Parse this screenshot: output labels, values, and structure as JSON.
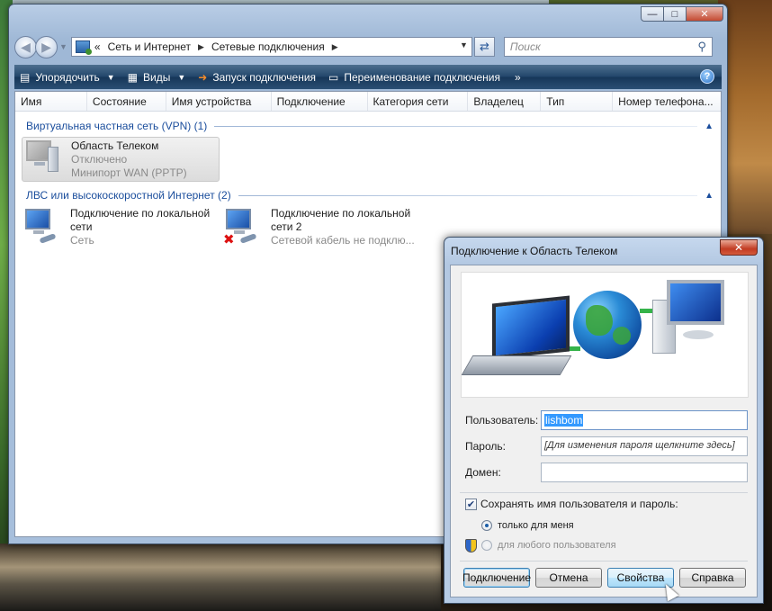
{
  "explorer": {
    "address": {
      "prefix": "«",
      "crumbs": [
        "Сеть и Интернет",
        "Сетевые подключения"
      ]
    },
    "search_placeholder": "Поиск",
    "toolbar": {
      "organize": "Упорядочить",
      "views": "Виды",
      "start_connection": "Запуск подключения",
      "rename_connection": "Переименование подключения",
      "more": "»"
    },
    "columns": [
      "Имя",
      "Состояние",
      "Имя устройства",
      "Подключение",
      "Категория сети",
      "Владелец",
      "Тип",
      "Номер телефона..."
    ],
    "groups": [
      {
        "title": "Виртуальная частная сеть (VPN) (1)",
        "items": [
          {
            "name": "Область Телеком",
            "status": "Отключено",
            "device": "Минипорт WAN (PPTP)"
          }
        ]
      },
      {
        "title": "ЛВС или высокоскоростной Интернет (2)",
        "items": [
          {
            "name_line1": "Подключение по локальной",
            "name_line2": "сети",
            "status": "Сеть"
          },
          {
            "name_line1": "Подключение по локальной",
            "name_line2": "сети 2",
            "status": "Сетевой кабель не подклю..."
          }
        ]
      }
    ]
  },
  "dialog": {
    "title": "Подключение к Область Телеком",
    "user_label": "Пользователь:",
    "user_value": "lishbom",
    "password_label": "Пароль:",
    "password_hint": "[Для изменения пароля щелкните здесь]",
    "domain_label": "Домен:",
    "domain_value": "",
    "save_checkbox_label": "Сохранять имя пользователя и пароль:",
    "save_checked": true,
    "radio_only_me": "только для меня",
    "radio_any_user": "для любого пользователя",
    "buttons": {
      "connect": "Подключение",
      "cancel": "Отмена",
      "properties": "Свойства",
      "help": "Справка"
    }
  },
  "colors": {
    "toolbar_bg": "#21456a",
    "group_header": "#1a4d9c",
    "selection_blue": "#3399ff"
  }
}
